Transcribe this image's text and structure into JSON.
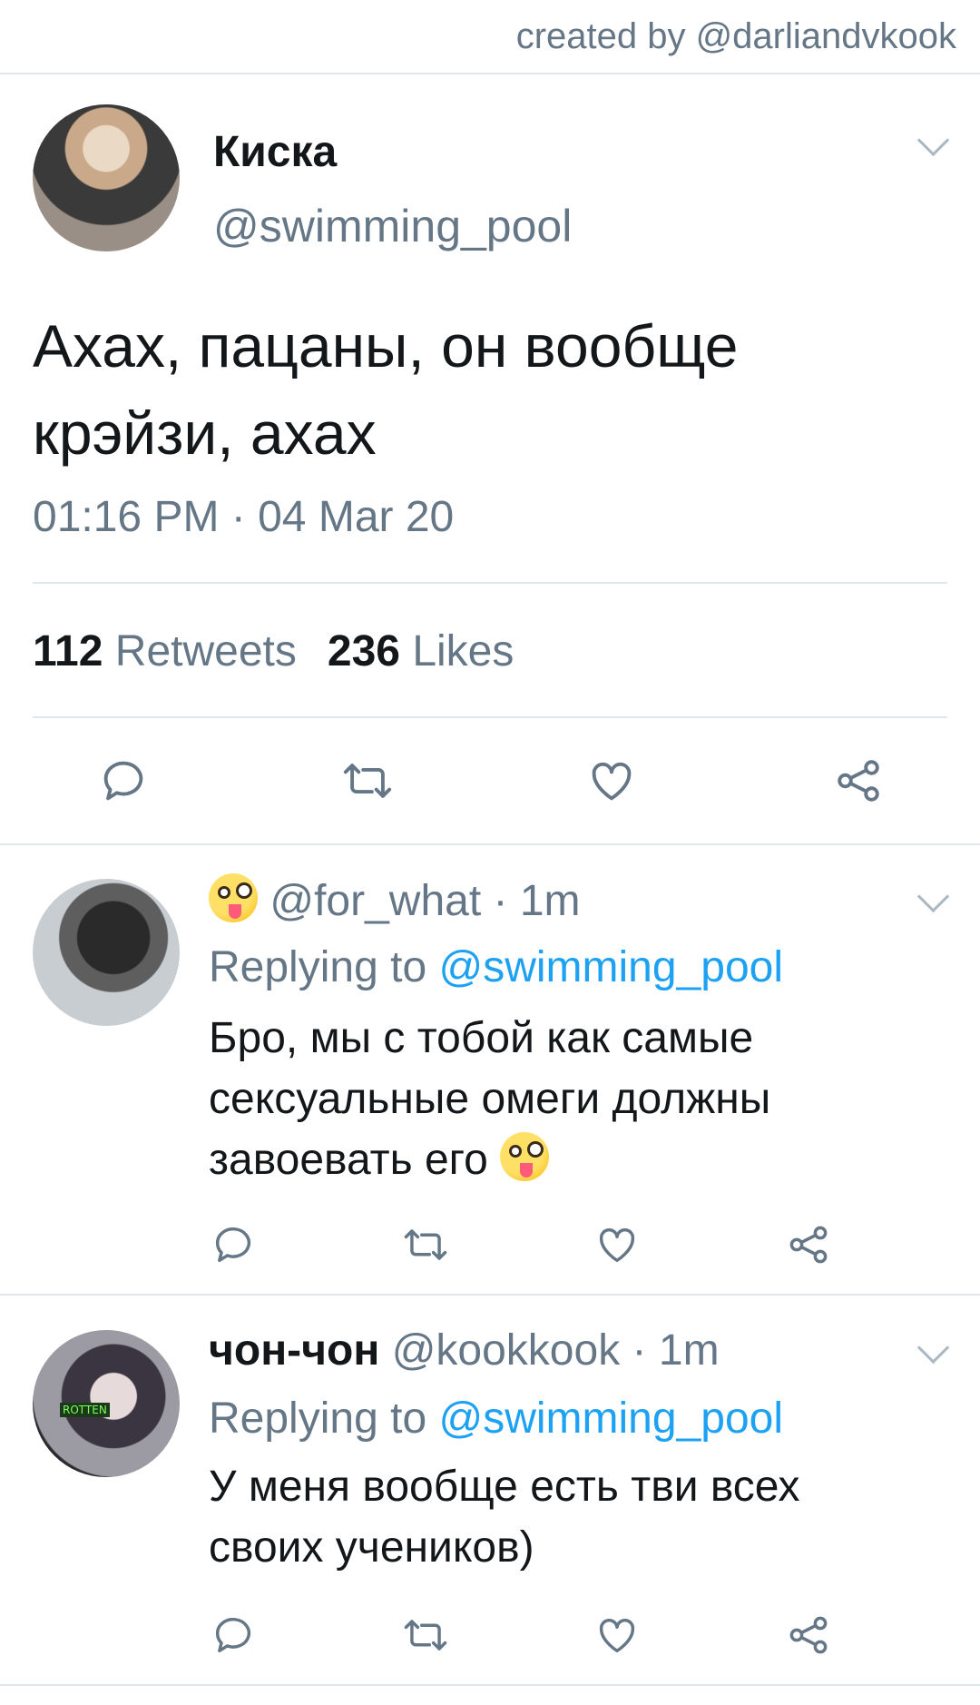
{
  "credit": "created by @darliandvkook",
  "main_tweet": {
    "name": "Киска",
    "handle": "@swimming_pool",
    "text_lines": [
      "Ахах, пацаны, он вообще",
      "крэйзи, ахах"
    ],
    "timestamp": "01:16 PM · 04 Mar 20",
    "retweets_count": "112",
    "retweets_label": "Retweets",
    "likes_count": "236",
    "likes_label": "Likes"
  },
  "replies": [
    {
      "name": "",
      "handle": "@for_what",
      "time": "· 1m",
      "replying_prefix": "Replying to",
      "replying_to": "@swimming_pool",
      "text_lines": [
        "Бро, мы с тобой как самые",
        "сексуальные омеги должны",
        "завоевать его"
      ],
      "emoji": "zany-face"
    },
    {
      "name": "чон-чон",
      "handle": "@kookkook",
      "time": "· 1m",
      "replying_prefix": "Replying to",
      "replying_to": "@swimming_pool",
      "text_lines": [
        "У меня вообще есть тви всех",
        "своих учеников)"
      ],
      "avatar_tag": "ROTTEN"
    }
  ],
  "icons": [
    "reply-icon",
    "retweet-icon",
    "like-icon",
    "share-icon",
    "chevron-down-icon"
  ],
  "colors": {
    "link": "#1da1f2",
    "secondary": "#657786",
    "divider": "#e1e8ed",
    "icon": "#657786"
  }
}
